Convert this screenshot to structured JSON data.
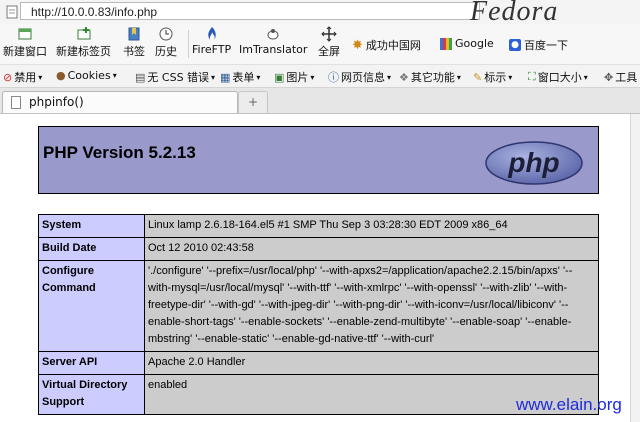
{
  "browser": {
    "url": "http://10.0.0.83/info.php",
    "watermark_logo": "Fedora",
    "toolbar": {
      "new_window": "新建窗口",
      "new_tab": "新建标签页",
      "bookmarks": "书签",
      "history": "历史",
      "fireftp": "FireFTP",
      "imtranslator": "ImTranslator",
      "fullscreen": "全屏",
      "chinanet": "成功中国网",
      "google": "Google",
      "baidu": "百度一下"
    },
    "toolbar2": {
      "disable": "禁用",
      "cookies": "Cookies",
      "css": "无 CSS 错误",
      "forms": "表单",
      "images": "图片",
      "info": "网页信息",
      "misc": "其它功能",
      "outline": "标示",
      "resize": "窗口大小",
      "tools": "工具"
    },
    "tab": {
      "title": "phpinfo()",
      "new_tab_symbol": "+"
    }
  },
  "page": {
    "title": "PHP Version 5.2.13",
    "logo_text": "php",
    "rows": [
      {
        "key": "System",
        "value": "Linux lamp 2.6.18-164.el5 #1 SMP Thu Sep 3 03:28:30 EDT 2009 x86_64"
      },
      {
        "key": "Build Date",
        "value": "Oct 12 2010 02:43:58"
      },
      {
        "key": "Configure Command",
        "value": "'./configure' '--prefix=/usr/local/php' '--with-apxs2=/application/apache2.2.15/bin/apxs' '--with-mysql=/usr/local/mysql' '--with-ttf' '--with-xmlrpc' '--with-openssl' '--with-zlib' '--with-freetype-dir' '--with-gd' '--with-jpeg-dir' '--with-png-dir' '--with-iconv=/usr/local/libiconv' '--enable-short-tags' '--enable-sockets' '--enable-zend-multibyte' '--enable-soap' '--enable-mbstring' '--enable-static' '--enable-gd-native-ttf' '--with-curl'"
      },
      {
        "key": "Server API",
        "value": "Apache 2.0 Handler"
      },
      {
        "key": "Virtual Directory Support",
        "value": "enabled"
      }
    ]
  },
  "watermark": "www.elain.org"
}
